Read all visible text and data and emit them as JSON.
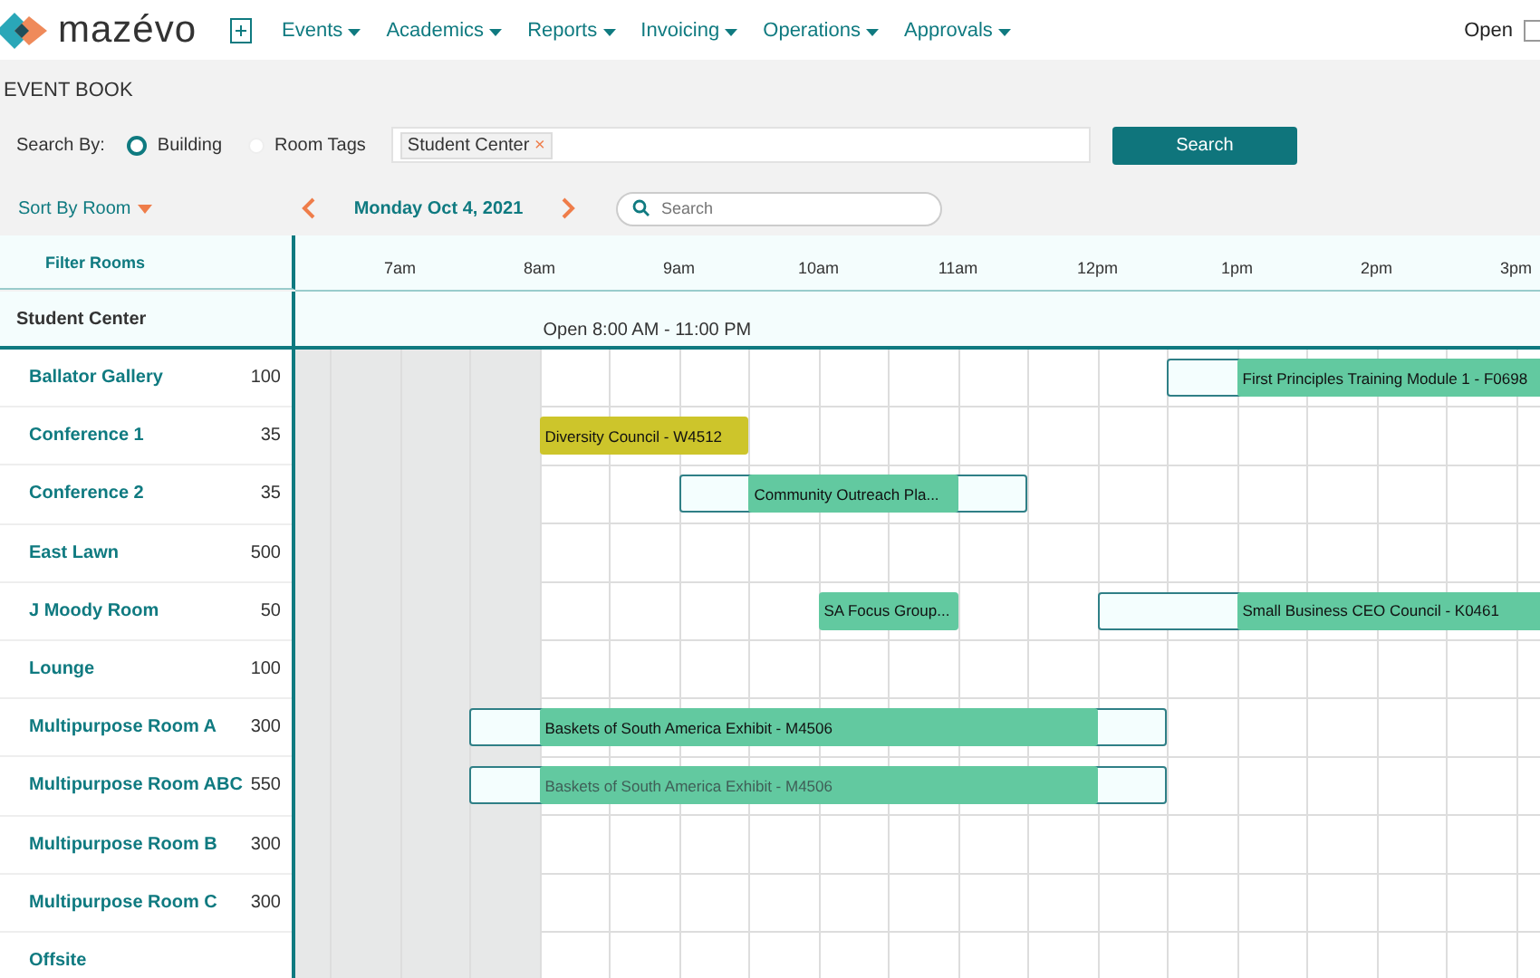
{
  "nav": {
    "brand": "mazévo",
    "menus": [
      "Events",
      "Academics",
      "Reports",
      "Invoicing",
      "Operations",
      "Approvals"
    ],
    "right_label": "Open"
  },
  "page_title": "EVENT BOOK",
  "search_by": {
    "label": "Search By:",
    "options": [
      {
        "label": "Building",
        "selected": true
      },
      {
        "label": "Room Tags",
        "selected": false
      }
    ],
    "chips": [
      "Student Center"
    ],
    "chip_remove": "×",
    "button": "Search"
  },
  "toolbar": {
    "sort": "Sort By Room",
    "date": "Monday Oct 4, 2021",
    "search_placeholder": "Search"
  },
  "grid": {
    "filter_label": "Filter Rooms",
    "hours": [
      "7am",
      "8am",
      "9am",
      "10am",
      "11am",
      "12pm",
      "1pm",
      "2pm",
      "3pm"
    ],
    "building": {
      "name": "Student Center",
      "hours_text": "Open 8:00 AM - 11:00 PM"
    },
    "rooms": [
      {
        "name": "Ballator Gallery",
        "capacity": "100",
        "events": [
          {
            "title": "First Principles Training Module 1 - F0698",
            "color": "#62c9a0",
            "dimmed": false
          }
        ]
      },
      {
        "name": "Conference 1",
        "capacity": "35",
        "events": [
          {
            "title": "Diversity Council - W4512",
            "color": "#cdc52b",
            "dimmed": false
          }
        ]
      },
      {
        "name": "Conference 2",
        "capacity": "35",
        "events": [
          {
            "title": "Community Outreach Pla...",
            "color": "#62c9a0",
            "dimmed": false
          }
        ]
      },
      {
        "name": "East Lawn",
        "capacity": "500"
      },
      {
        "name": "J Moody Room",
        "capacity": "50",
        "events": [
          {
            "title": "SA Focus Group...",
            "color": "#62c9a0",
            "dimmed": false
          },
          {
            "title": "Small Business CEO Council - K0461",
            "color": "#62c9a0",
            "dimmed": false
          }
        ]
      },
      {
        "name": "Lounge",
        "capacity": "100"
      },
      {
        "name": "Multipurpose Room A",
        "capacity": "300",
        "events": [
          {
            "title": "Baskets of South America Exhibit - M4506",
            "color": "#62c9a0",
            "dimmed": false
          }
        ]
      },
      {
        "name": "Multipurpose Room ABC",
        "capacity": "550",
        "events": [
          {
            "title": "Baskets of South America Exhibit - M4506",
            "color": "#62c9a0",
            "dimmed": true
          }
        ]
      },
      {
        "name": "Multipurpose Room B",
        "capacity": "300"
      },
      {
        "name": "Multipurpose Room C",
        "capacity": "300"
      },
      {
        "name": "Offsite"
      }
    ]
  }
}
